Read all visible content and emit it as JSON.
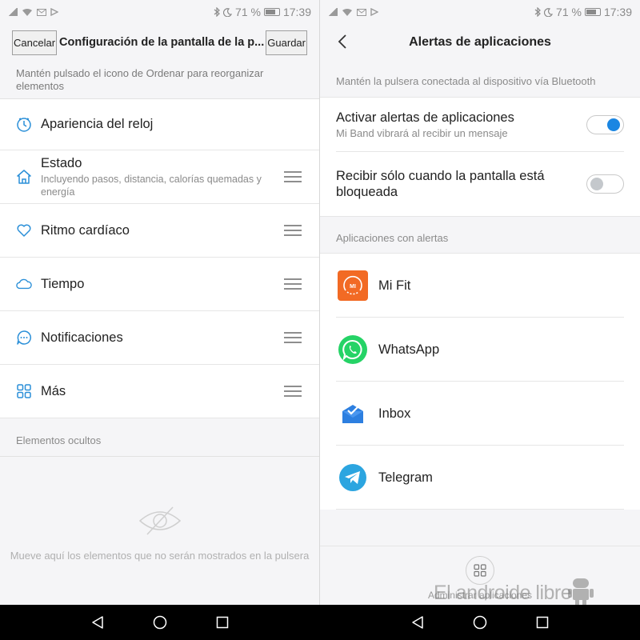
{
  "status_bar": {
    "battery": "71 %",
    "time": "17:39"
  },
  "left": {
    "header": {
      "cancel_label": "Cancelar",
      "title": "Configuración de la pantalla de la p...",
      "save_label": "Guardar"
    },
    "hint": "Mantén pulsado el icono de Ordenar para reorganizar elementos",
    "items": [
      {
        "label": "Apariencia del reloj",
        "icon": "clock-icon"
      },
      {
        "label": "Estado",
        "sub": "Incluyendo pasos, distancia, calorías quemadas y energía",
        "icon": "home-icon"
      },
      {
        "label": "Ritmo cardíaco",
        "icon": "heart-icon"
      },
      {
        "label": "Tiempo",
        "icon": "cloud-icon"
      },
      {
        "label": "Notificaciones",
        "icon": "chat-bubble-icon"
      },
      {
        "label": "Más",
        "icon": "grid-icon"
      }
    ],
    "hidden_section_title": "Elementos ocultos",
    "hidden_message": "Mueve aquí los elementos que no serán mostrados en la pulsera"
  },
  "right": {
    "header": {
      "title": "Alertas de aplicaciones"
    },
    "hint": "Mantén la pulsera conectada al dispositivo vía Bluetooth",
    "toggles": [
      {
        "label": "Activar alertas de aplicaciones",
        "sub": "Mi Band vibrará al recibir un mensaje",
        "on": true
      },
      {
        "label": "Recibir sólo cuando la pantalla está bloqueada",
        "on": false
      }
    ],
    "apps_section_title": "Aplicaciones con alertas",
    "apps": [
      {
        "name": "Mi Fit",
        "icon": "mi-fit-icon"
      },
      {
        "name": "WhatsApp",
        "icon": "whatsapp-icon"
      },
      {
        "name": "Inbox",
        "icon": "inbox-icon"
      },
      {
        "name": "Telegram",
        "icon": "telegram-icon"
      }
    ],
    "manage_label": "Administrar aplicaciones",
    "watermark": "El androide libre"
  },
  "colors": {
    "accent": "#1a86e2",
    "mi_orange": "#f26a24",
    "whatsapp_green": "#25d366",
    "telegram_blue": "#2ca5e0"
  }
}
